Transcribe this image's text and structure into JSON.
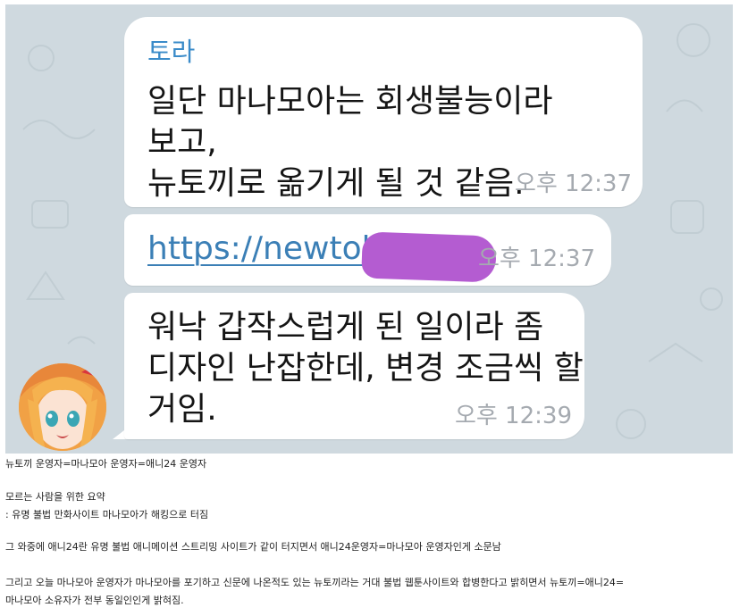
{
  "chat": {
    "messages": [
      {
        "sender": "토라",
        "lines": [
          "일단 마나모아는 회생불능이라",
          "보고,",
          "뉴토끼로 옮기게 될 것 같음."
        ],
        "time": "오후 12:37"
      },
      {
        "link": "https://newtoki",
        "time": "오후 12:37"
      },
      {
        "lines": [
          "워낙 갑작스럽게 된 일이라 좀",
          "디자인 난잡한데, 변경 조금씩 할",
          "거임."
        ],
        "time": "오후 12:39"
      }
    ]
  },
  "article": {
    "line1": "뉴토끼 운영자=마나모아 운영자=애니24 운영자",
    "line2": "모르는 사람을 위한 요약",
    "line3": ": 유명 불법 만화사이트 마나모아가 해킹으로 터짐",
    "line4": "그 와중에 애니24란 유명 불법 애니메이션 스트리밍 사이트가 같이 터지면서 애니24운영자=마나모아 운영자인게 소문남",
    "line5": "그리고 오늘 마나모아 운영자가 마나모아를 포기하고 신문에 나온적도 있는 뉴토끼라는 거대 불법 웹툰사이트와 합병한다고 밝히면서 뉴토끼=애니24=",
    "line6": "마나모아 소유자가 전부 동일인인게 밝혀짐."
  },
  "colors": {
    "chat_background": "#cfd9df",
    "sender_name": "#3a8bc9",
    "link": "#3b7fb6",
    "timestamp": "#a5aab0",
    "redaction": "#b45cd1"
  }
}
